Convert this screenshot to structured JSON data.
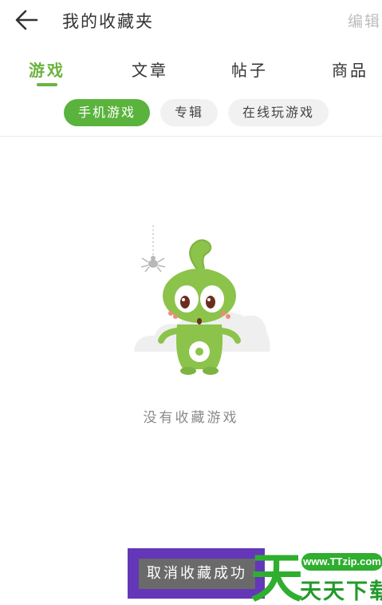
{
  "header": {
    "title": "我的收藏夹",
    "edit_label": "编辑",
    "back_icon": "arrow-left-icon"
  },
  "tabs": [
    {
      "label": "游戏",
      "active": true
    },
    {
      "label": "文章",
      "active": false
    },
    {
      "label": "帖子",
      "active": false
    },
    {
      "label": "商品",
      "active": false
    }
  ],
  "filters": [
    {
      "label": "手机游戏",
      "active": true
    },
    {
      "label": "专辑",
      "active": false
    },
    {
      "label": "在线玩游戏",
      "active": false
    }
  ],
  "empty_state": {
    "message": "没有收藏游戏",
    "illustration": "green-mascot-with-spider"
  },
  "toast": {
    "message": "取消收藏成功"
  },
  "watermark": {
    "url": "www.TTzip.com",
    "text": "天天下载",
    "logo_char": "天"
  },
  "colors": {
    "accent": "#5ab33c",
    "toast_border": "#6437b8",
    "watermark_green": "#239a2a"
  }
}
